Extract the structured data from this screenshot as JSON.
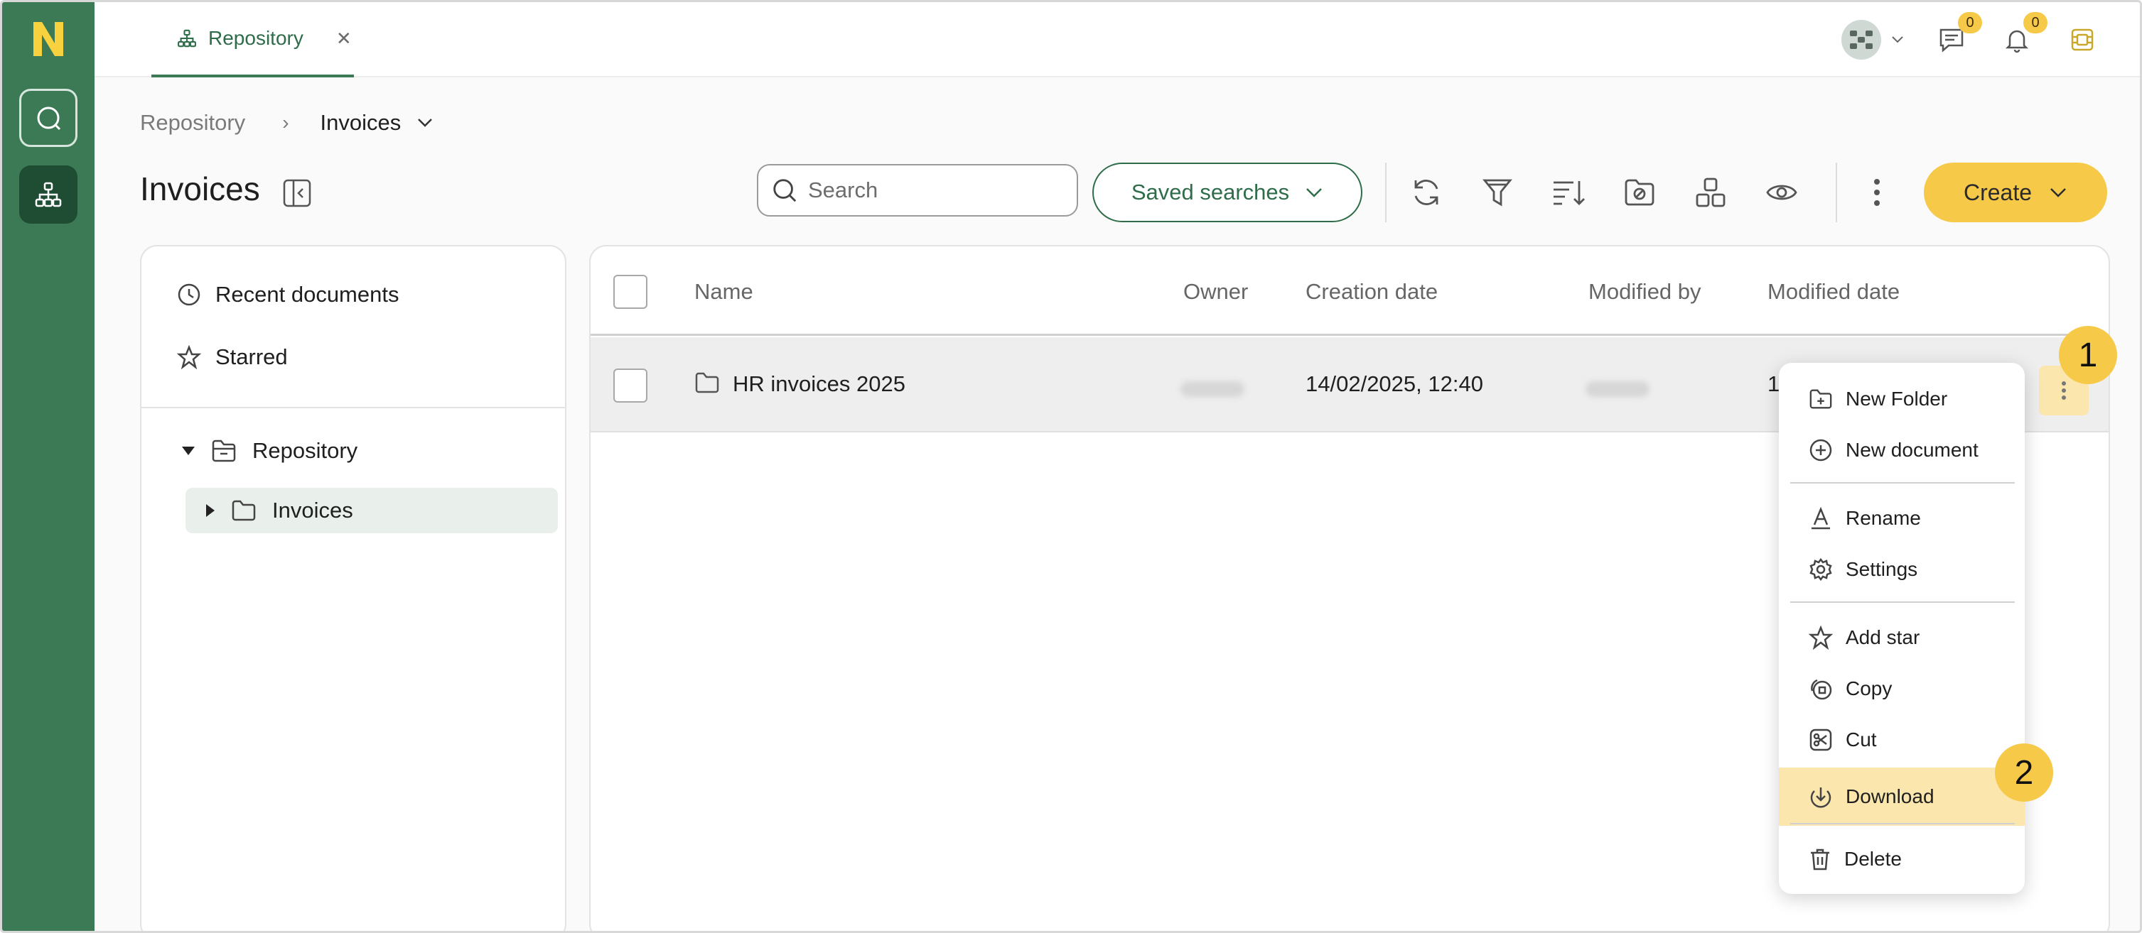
{
  "colors": {
    "rail": "#3b7a55",
    "accent": "#2f6d4a",
    "brand_yellow": "#f7c948",
    "highlight": "#fbe7ad"
  },
  "tab": {
    "label": "Repository",
    "close_icon": "close-icon"
  },
  "header": {
    "chat_badge": "0",
    "notifications_badge": "0"
  },
  "breadcrumb": {
    "root": "Repository",
    "current": "Invoices"
  },
  "page": {
    "title": "Invoices"
  },
  "toolbar": {
    "search_placeholder": "Search",
    "saved_searches_label": "Saved searches",
    "create_label": "Create",
    "icons": [
      "refresh-icon",
      "filter-icon",
      "sort-icon",
      "hide-icon",
      "layout-icon",
      "preview-icon",
      "more-icon"
    ]
  },
  "sidebar": {
    "recent_label": "Recent documents",
    "starred_label": "Starred",
    "tree": {
      "root": "Repository",
      "child": "Invoices"
    }
  },
  "table": {
    "columns": [
      "Name",
      "Owner",
      "Creation date",
      "Modified by",
      "Modified date"
    ],
    "rows": [
      {
        "name": "HR invoices 2025",
        "creation_date": "14/02/2025, 12:40",
        "modified_date_partial": "1"
      }
    ]
  },
  "context_menu": {
    "items": [
      "New Folder",
      "New document",
      "Rename",
      "Settings",
      "Add star",
      "Copy",
      "Cut",
      "Download",
      "Delete"
    ],
    "highlighted": "Download"
  },
  "steps": {
    "first": "1",
    "second": "2"
  }
}
